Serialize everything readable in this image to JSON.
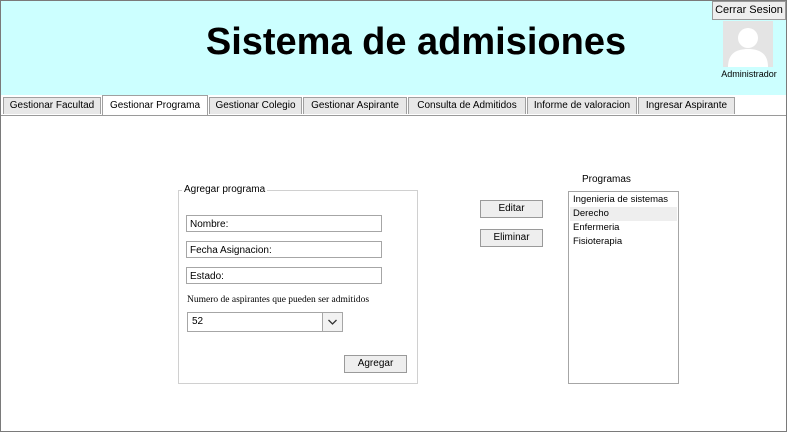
{
  "header": {
    "title": "Sistema de admisiones",
    "logout_label": "Cerrar Sesion",
    "user_label": "Administrador"
  },
  "tabs": [
    {
      "label": "Gestionar Facultad"
    },
    {
      "label": "Gestionar Programa",
      "active": true
    },
    {
      "label": "Gestionar Colegio"
    },
    {
      "label": "Gestionar Aspirante"
    },
    {
      "label": "Consulta de Admitidos"
    },
    {
      "label": "Informe de valoracion"
    },
    {
      "label": "Ingresar Aspirante"
    }
  ],
  "form": {
    "legend": "Agregar programa",
    "name_value": "Nombre:",
    "date_value": "Fecha Asignacion:",
    "status_value": "Estado:",
    "count_label": "Numero de aspirantes que pueden ser admitidos",
    "count_value": "52",
    "add_label": "Agregar"
  },
  "actions": {
    "edit_label": "Editar",
    "delete_label": "Eliminar"
  },
  "programs": {
    "label": "Programas",
    "items": [
      {
        "label": "Ingenieria de sistemas"
      },
      {
        "label": "Derecho",
        "selected": true
      },
      {
        "label": "Enfermeria"
      },
      {
        "label": "Fisioterapia"
      }
    ]
  },
  "icons": {
    "avatar": "user-avatar-icon",
    "dropdown": "chevron-down-icon"
  },
  "colors": {
    "header_bg": "#ccffff"
  }
}
